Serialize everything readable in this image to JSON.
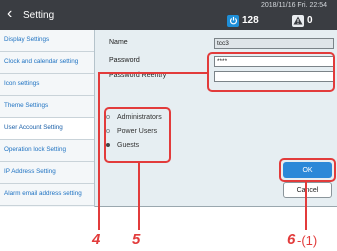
{
  "topbar": {
    "title": "Setting",
    "datetime": "2018/11/16 Fri. 22:54",
    "count": "128",
    "alert_count": "0"
  },
  "sidebar": {
    "items": [
      {
        "label": "Display Settings"
      },
      {
        "label": "Clock and calendar setting"
      },
      {
        "label": "Icon settings"
      },
      {
        "label": "Theme Settings"
      },
      {
        "label": "User Account Setting",
        "active": true
      },
      {
        "label": "Operation lock Setting"
      },
      {
        "label": "IP Address Setting"
      },
      {
        "label": "Alarm email address setting"
      }
    ]
  },
  "form": {
    "name_label": "Name",
    "name_value": "tcc3",
    "password_label": "Password",
    "password_value": "****",
    "reentry_label": "Password Reentry",
    "reentry_value": ""
  },
  "roles": {
    "options": [
      "Administrators",
      "Power Users",
      "Guests"
    ],
    "selected": "Guests"
  },
  "buttons": {
    "ok": "OK",
    "cancel": "Cancel"
  },
  "callouts": {
    "c4": "4",
    "c5": "5",
    "c6": "6",
    "c6_sub": "-(1)"
  },
  "colors": {
    "accent": "#2b88d8",
    "callout": "#e23b3b",
    "topbar": "#3a3d42"
  }
}
